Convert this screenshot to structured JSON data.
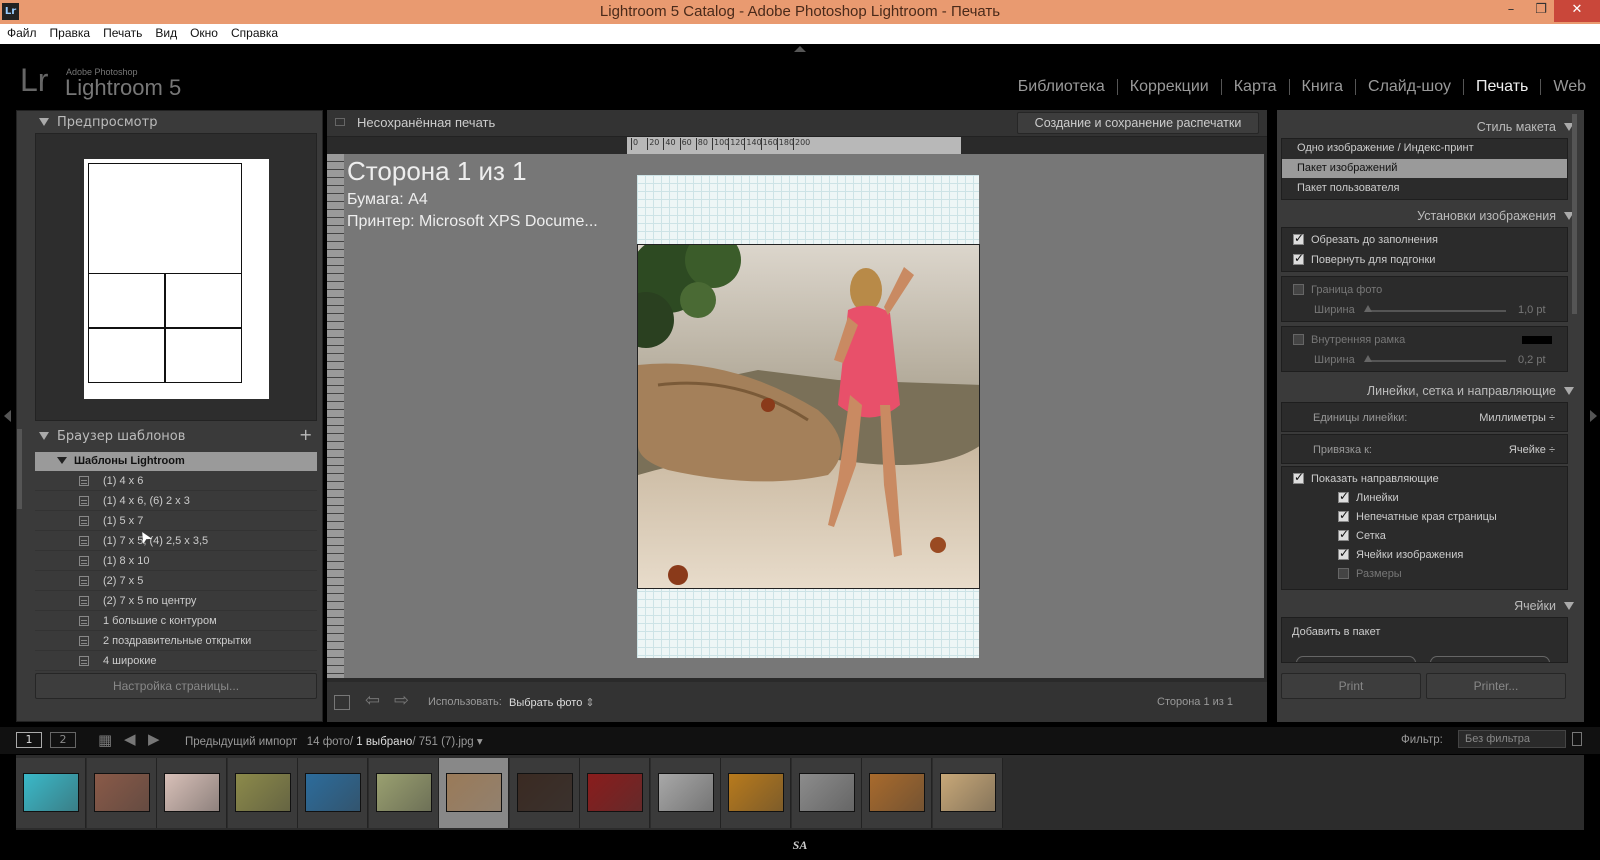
{
  "window": {
    "title": "Lightroom 5 Catalog - Adobe Photoshop Lightroom - Печать",
    "icon": "Lr"
  },
  "menu": [
    "Файл",
    "Правка",
    "Печать",
    "Вид",
    "Окно",
    "Справка"
  ],
  "identity": {
    "logo": "Lr",
    "brand": "Adobe Photoshop",
    "product": "Lightroom 5"
  },
  "modules": [
    "Библиотека",
    "Коррекции",
    "Карта",
    "Книга",
    "Слайд-шоу",
    "Печать",
    "Web"
  ],
  "left": {
    "preview_title": "Предпросмотр",
    "browser_title": "Браузер шаблонов",
    "add_symbol": "+",
    "folder": "Шаблоны Lightroom",
    "templates": [
      "(1) 4 x 6",
      "(1) 4 x 6, (6) 2 x 3",
      "(1) 5 x 7",
      "(1) 7 x 5, (4) 2,5 x 3,5",
      "(1) 8 x 10",
      "(2) 7 x 5",
      "(2) 7 x 5 по центру",
      "1 большие с контуром",
      "2 поздравительные открытки",
      "4 широкие"
    ],
    "page_setup_button": "Настройка страницы..."
  },
  "center": {
    "doc_title": "Несохранённая печать",
    "save_button": "Создание и сохранение распечатки",
    "ruler_ticks": [
      "0",
      "20",
      "40",
      "60",
      "80",
      "100",
      "120",
      "140",
      "160",
      "180",
      "200"
    ],
    "page_heading": "Сторона 1 из 1",
    "paper_line": "Бумага:  A4",
    "printer_line": "Принтер:  Microsoft XPS Docume...",
    "use_label": "Использовать:",
    "use_value": "Выбрать фото",
    "page_count": "Сторона 1 из 1"
  },
  "right": {
    "layout_style_title": "Стиль макета",
    "layout_styles": [
      "Одно изображение / Индекс-принт",
      "Пакет изображений",
      "Пакет пользователя"
    ],
    "layout_selected_index": 1,
    "image_settings_title": "Установки изображения",
    "crop_fill": "Обрезать до заполнения",
    "rotate_fit": "Повернуть для подгонки",
    "photo_border": "Граница фото",
    "width_label": "Ширина",
    "border_width": "1,0 pt",
    "inner_stroke": "Внутренняя рамка",
    "inner_width": "0,2 pt",
    "rulers_title": "Линейки, сетка и направляющие",
    "ruler_units_label": "Единицы линейки:",
    "ruler_units_value": "Миллиметры ÷",
    "snap_label": "Привязка к:",
    "snap_value": "Ячейке ÷",
    "show_guides": "Показать направляющие",
    "guides": [
      {
        "label": "Линейки",
        "checked": true
      },
      {
        "label": "Непечатные края страницы",
        "checked": true
      },
      {
        "label": "Сетка",
        "checked": true
      },
      {
        "label": "Ячейки изображения",
        "checked": true
      },
      {
        "label": "Размеры",
        "checked": false
      }
    ],
    "cells_title": "Ячейки",
    "add_to_package": "Добавить в пакет",
    "print_button": "Print",
    "printer_button": "Printer..."
  },
  "filmstrip": {
    "view1": "1",
    "view2": "2",
    "source": "Предыдущий импорт",
    "count": "14 фото/",
    "selected": "1 выбрано",
    "file": "/ 751 (7).jpg",
    "filter_label": "Фильтр:",
    "filter_value": "Без фильтра",
    "thumb_colors": [
      "#3ab9c9",
      "#8a5a48",
      "#d8c0b8",
      "#8c8a4a",
      "#2c6c9c",
      "#9aa070",
      "#9a7a58",
      "#3a2a22",
      "#8a1c1c",
      "#a8a8a8",
      "#b87a1c",
      "#8c8c8c",
      "#a86a2c",
      "#c8a878"
    ],
    "selected_index": 6
  },
  "footer": "SA"
}
